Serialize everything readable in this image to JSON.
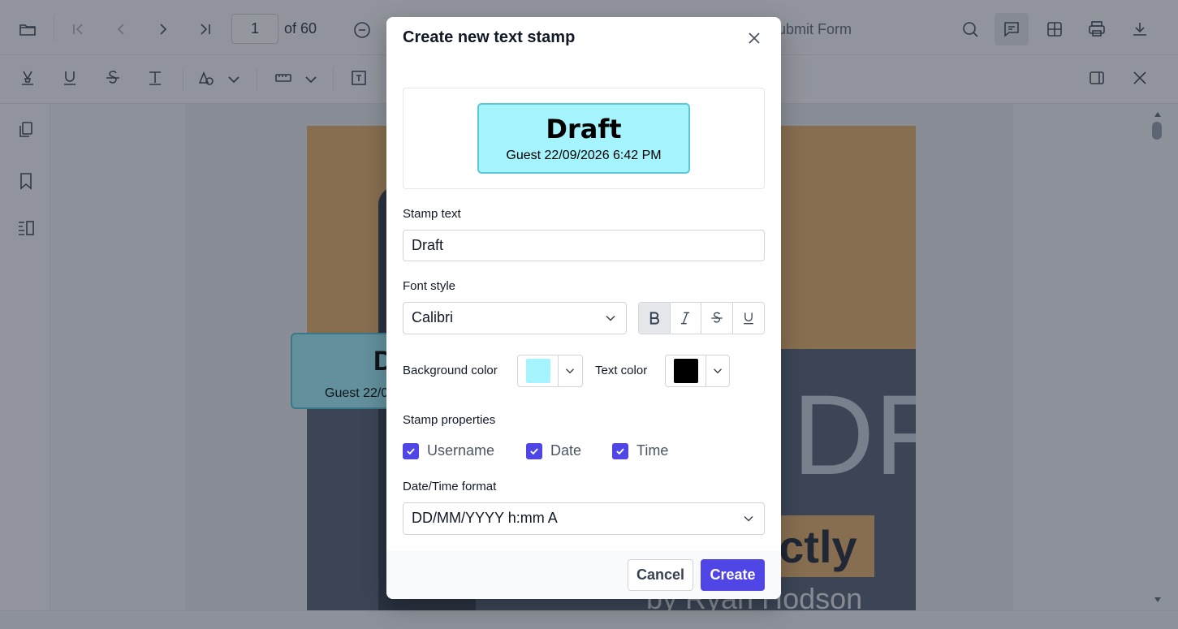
{
  "toolbar": {
    "page_number": "1",
    "page_of": "of 60",
    "submit_form_partial": "ubmit Form"
  },
  "document": {
    "cover_letters": "DF",
    "cover_highlight": "actly",
    "cover_author": "by Ryan Hodson"
  },
  "placed_stamp": {
    "title": "D",
    "subtitle": "Guest 22/0"
  },
  "dialog": {
    "title": "Create new text stamp",
    "preview": {
      "title": "Draft",
      "subtitle": "Guest 22/09/2026 6:42 PM",
      "background": "#a5f3fc",
      "border": "#5ec7d6"
    },
    "stamp_text_label": "Stamp text",
    "stamp_text_value": "Draft",
    "font_style_label": "Font style",
    "font_value": "Calibri",
    "format_buttons": [
      "bold",
      "italic",
      "strikethrough",
      "underline"
    ],
    "bold_active": true,
    "background_color_label": "Background color",
    "background_color": "#a5f3fc",
    "text_color_label": "Text color",
    "text_color": "#000000",
    "stamp_properties_label": "Stamp properties",
    "properties": [
      {
        "label": "Username",
        "checked": true
      },
      {
        "label": "Date",
        "checked": true
      },
      {
        "label": "Time",
        "checked": true
      }
    ],
    "datetime_format_label": "Date/Time format",
    "datetime_format_value": "DD/MM/YYYY h:mm A",
    "cancel_label": "Cancel",
    "create_label": "Create",
    "accent_color": "#4f46e5"
  }
}
